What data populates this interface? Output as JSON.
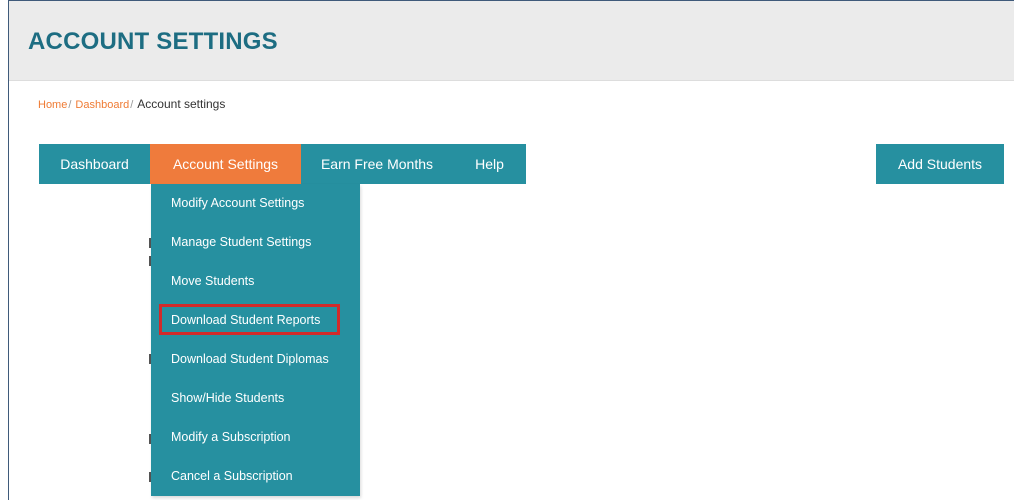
{
  "header": {
    "title": "ACCOUNT SETTINGS"
  },
  "breadcrumb": {
    "items": [
      "Home",
      "Dashboard"
    ],
    "separator": "/",
    "current": "Account settings"
  },
  "nav": {
    "items": [
      "Dashboard",
      "Account Settings",
      "Earn Free Months",
      "Help"
    ],
    "active": "Account Settings"
  },
  "actions": {
    "add_students_label": "Add Students"
  },
  "dropdown": {
    "items": [
      "Modify Account Settings",
      "Manage Student Settings",
      "Move Students",
      "Download Student Reports",
      "Download Student Diplomas",
      "Show/Hide Students",
      "Modify a Subscription",
      "Cancel a Subscription"
    ],
    "highlighted": "Download Student Reports"
  },
  "colors": {
    "teal": "#2690a0",
    "orange": "#ef7b3c",
    "title_teal": "#1d6d82",
    "highlight_red": "#d12a2a",
    "header_bg": "#ebebeb"
  }
}
